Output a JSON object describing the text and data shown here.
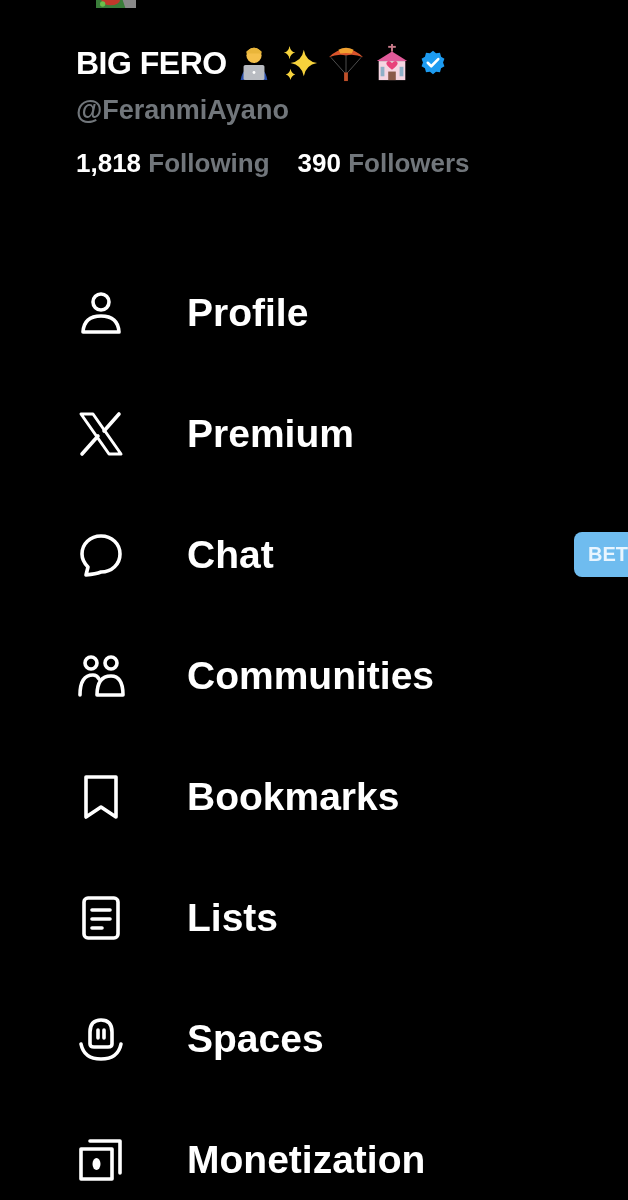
{
  "profile": {
    "name": "BIG FERO",
    "verified": true,
    "handle": "@FeranmiAyano",
    "following_count": "1,818",
    "following_label": "Following",
    "followers_count": "390",
    "followers_label": "Followers"
  },
  "menu": [
    {
      "kind": "profile",
      "label": "Profile"
    },
    {
      "kind": "premium",
      "label": "Premium"
    },
    {
      "kind": "chat",
      "label": "Chat",
      "badge": "BET"
    },
    {
      "kind": "communities",
      "label": "Communities"
    },
    {
      "kind": "bookmarks",
      "label": "Bookmarks"
    },
    {
      "kind": "lists",
      "label": "Lists"
    },
    {
      "kind": "spaces",
      "label": "Spaces"
    },
    {
      "kind": "monetization",
      "label": "Monetization"
    }
  ]
}
